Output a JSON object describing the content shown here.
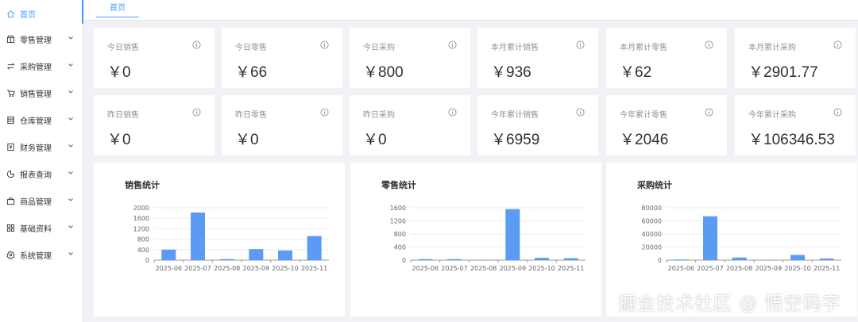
{
  "sidebar": {
    "items": [
      {
        "label": "首页",
        "icon": "home-icon",
        "active": true,
        "expandable": false
      },
      {
        "label": "零售管理",
        "icon": "shop-icon",
        "active": false,
        "expandable": true
      },
      {
        "label": "采购管理",
        "icon": "swap-icon",
        "active": false,
        "expandable": true
      },
      {
        "label": "销售管理",
        "icon": "cart-icon",
        "active": false,
        "expandable": true
      },
      {
        "label": "仓库管理",
        "icon": "warehouse-icon",
        "active": false,
        "expandable": true
      },
      {
        "label": "财务管理",
        "icon": "account-book-icon",
        "active": false,
        "expandable": true
      },
      {
        "label": "报表查询",
        "icon": "pie-chart-icon",
        "active": false,
        "expandable": true
      },
      {
        "label": "商品管理",
        "icon": "goods-icon",
        "active": false,
        "expandable": true
      },
      {
        "label": "基础资料",
        "icon": "appstore-icon",
        "active": false,
        "expandable": true
      },
      {
        "label": "系统管理",
        "icon": "setting-icon",
        "active": false,
        "expandable": true
      }
    ]
  },
  "tabs": [
    {
      "label": "首页",
      "active": true
    }
  ],
  "stats": [
    {
      "title": "今日销售",
      "value": "￥0"
    },
    {
      "title": "今日零售",
      "value": "￥66"
    },
    {
      "title": "今日采购",
      "value": "￥800"
    },
    {
      "title": "本月累计销售",
      "value": "￥936"
    },
    {
      "title": "本月累计零售",
      "value": "￥62"
    },
    {
      "title": "本月累计采购",
      "value": "￥2901.77"
    },
    {
      "title": "昨日销售",
      "value": "￥0"
    },
    {
      "title": "昨日零售",
      "value": "￥0"
    },
    {
      "title": "昨日采购",
      "value": "￥0"
    },
    {
      "title": "今年累计销售",
      "value": "￥6959"
    },
    {
      "title": "今年累计零售",
      "value": "￥2046"
    },
    {
      "title": "今年累计采购",
      "value": "￥106346.53"
    }
  ],
  "colors": {
    "accent": "#409eff",
    "bar": "#5b9bf4"
  },
  "chart_data": [
    {
      "type": "bar",
      "title": "销售统计",
      "categories": [
        "2025-06",
        "2025-07",
        "2025-08",
        "2025-09",
        "2025-10",
        "2025-11"
      ],
      "values": [
        400,
        1820,
        40,
        420,
        370,
        920
      ],
      "ylim": [
        0,
        2000
      ],
      "yticks": [
        0,
        400,
        800,
        1200,
        1600,
        2000
      ],
      "grid": true
    },
    {
      "type": "bar",
      "title": "零售统计",
      "categories": [
        "2025-06",
        "2025-07",
        "2025-08",
        "2025-09",
        "2025-10",
        "2025-11"
      ],
      "values": [
        30,
        30,
        5,
        1560,
        70,
        60
      ],
      "ylim": [
        0,
        1600
      ],
      "yticks": [
        0,
        400,
        800,
        1200,
        1600
      ],
      "grid": true
    },
    {
      "type": "bar",
      "title": "采购统计",
      "categories": [
        "2025-06",
        "2025-07",
        "2025-08",
        "2025-09",
        "2025-10",
        "2025-11"
      ],
      "values": [
        1000,
        67000,
        4000,
        500,
        8000,
        2500
      ],
      "ylim": [
        0,
        80000
      ],
      "yticks": [
        0,
        20000,
        40000,
        60000,
        80000
      ],
      "grid": true
    }
  ],
  "watermark": "掘金技术社区 @ 悟空码字"
}
